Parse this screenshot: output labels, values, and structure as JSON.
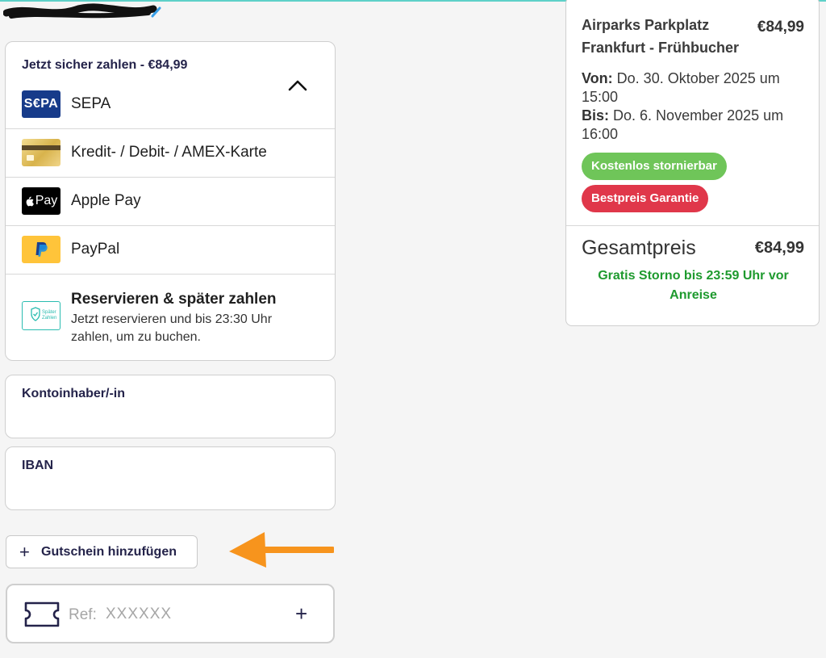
{
  "payment": {
    "title": "Jetzt sicher zahlen - €84,99",
    "methods": [
      {
        "label": "SEPA",
        "icon": "sepa-icon"
      },
      {
        "label": "Kredit- / Debit- / AMEX-Karte",
        "icon": "credit-card-icon"
      },
      {
        "label": "Apple Pay",
        "icon": "apple-pay-icon"
      },
      {
        "label": "PayPal",
        "icon": "paypal-icon"
      }
    ],
    "pay_later": {
      "title": "Reservieren & später zahlen",
      "text": "Jetzt reservieren und bis 23:30 Uhr zahlen, um zu buchen.",
      "logo_text_1": "Später",
      "logo_text_2": "Zahlen"
    },
    "sepa_logo": "S€PA",
    "apple_logo": "Pay"
  },
  "fields": {
    "account_holder_label": "Kontoinhaber/-in",
    "iban_label": "IBAN"
  },
  "voucher": {
    "button_label": "Gutschein hinzufügen",
    "ref_prefix": "Ref:",
    "ref_placeholder": "XXXXXX"
  },
  "summary": {
    "title": "Airparks Parkplatz Frankfurt - Frühbucher",
    "price": "€84,99",
    "from_label": "Von:",
    "from_value": "Do. 30. Oktober 2025 um 15:00",
    "to_label": "Bis:",
    "to_value": "Do. 6. November 2025 um 16:00",
    "badge_free_cancel": "Kostenlos stornierbar",
    "badge_best_price": "Bestpreis Garantie",
    "total_label": "Gesamtpreis",
    "total_value": "€84,99",
    "note": "Gratis Storno bis 23:59 Uhr vor Anreise"
  },
  "colors": {
    "accent_navy": "#24234a",
    "green_badge": "#6fc559",
    "red_badge": "#e0374a",
    "arrow_orange": "#f7941d",
    "note_green": "#1e9a2e"
  }
}
